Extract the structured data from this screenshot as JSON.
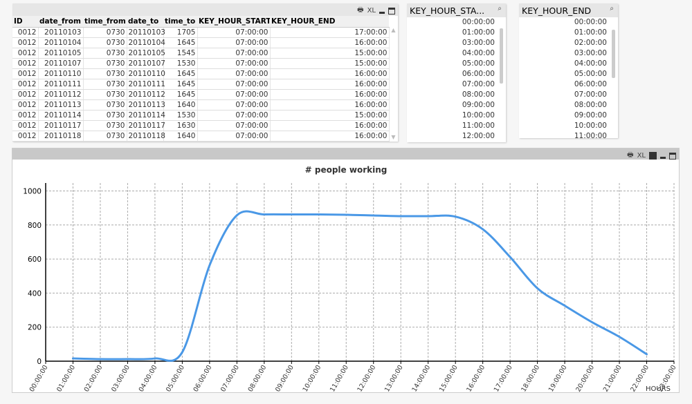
{
  "table": {
    "icons": [
      "print-icon",
      "xl-icon",
      "minimize-icon",
      "maximize-icon"
    ],
    "xl_label": "XL",
    "columns": [
      "ID",
      "date_from",
      "time_from",
      "date_to",
      "time_to",
      "KEY_HOUR_START",
      "KEY_HOUR_END"
    ],
    "rows": [
      [
        "0012",
        "20110103",
        "0730",
        "20110103",
        "1705",
        "07:00:00",
        "17:00:00"
      ],
      [
        "0012",
        "20110104",
        "0730",
        "20110104",
        "1645",
        "07:00:00",
        "16:00:00"
      ],
      [
        "0012",
        "20110105",
        "0730",
        "20110105",
        "1545",
        "07:00:00",
        "15:00:00"
      ],
      [
        "0012",
        "20110107",
        "0730",
        "20110107",
        "1530",
        "07:00:00",
        "15:00:00"
      ],
      [
        "0012",
        "20110110",
        "0730",
        "20110110",
        "1645",
        "07:00:00",
        "16:00:00"
      ],
      [
        "0012",
        "20110111",
        "0730",
        "20110111",
        "1645",
        "07:00:00",
        "16:00:00"
      ],
      [
        "0012",
        "20110112",
        "0730",
        "20110112",
        "1645",
        "07:00:00",
        "16:00:00"
      ],
      [
        "0012",
        "20110113",
        "0730",
        "20110113",
        "1640",
        "07:00:00",
        "16:00:00"
      ],
      [
        "0012",
        "20110114",
        "0730",
        "20110114",
        "1530",
        "07:00:00",
        "15:00:00"
      ],
      [
        "0012",
        "20110117",
        "0730",
        "20110117",
        "1630",
        "07:00:00",
        "16:00:00"
      ],
      [
        "0012",
        "20110118",
        "0730",
        "20110118",
        "1640",
        "07:00:00",
        "16:00:00"
      ]
    ]
  },
  "listbox_start": {
    "title": "KEY_HOUR_STA...",
    "items": [
      "00:00:00",
      "01:00:00",
      "03:00:00",
      "04:00:00",
      "05:00:00",
      "06:00:00",
      "07:00:00",
      "08:00:00",
      "09:00:00",
      "10:00:00",
      "11:00:00",
      "12:00:00"
    ]
  },
  "listbox_end": {
    "title": "KEY_HOUR_END",
    "items": [
      "00:00:00",
      "01:00:00",
      "02:00:00",
      "03:00:00",
      "04:00:00",
      "05:00:00",
      "06:00:00",
      "07:00:00",
      "08:00:00",
      "09:00:00",
      "10:00:00",
      "11:00:00"
    ]
  },
  "chart_caption": {
    "xl_label": "XL"
  },
  "chart_data": {
    "type": "line",
    "title": "# people working",
    "xlabel": "HOURS",
    "ylabel": "",
    "x_ticks": [
      "00:00:00",
      "01:00:00",
      "02:00:00",
      "03:00:00",
      "04:00:00",
      "05:00:00",
      "06:00:00",
      "07:00:00",
      "08:00:00",
      "09:00:00",
      "10:00:00",
      "11:00:00",
      "12:00:00",
      "13:00:00",
      "14:00:00",
      "15:00:00",
      "16:00:00",
      "17:00:00",
      "18:00:00",
      "19:00:00",
      "20:00:00",
      "21:00:00",
      "22:00:00",
      "23:00:00"
    ],
    "y_ticks": [
      0,
      200,
      400,
      600,
      800,
      1000
    ],
    "ylim": [
      0,
      1050
    ],
    "grid": true,
    "line_color": "#4a98e6",
    "x": [
      "01:00:00",
      "02:00:00",
      "03:00:00",
      "04:00:00",
      "05:00:00",
      "06:00:00",
      "07:00:00",
      "08:00:00",
      "09:00:00",
      "10:00:00",
      "11:00:00",
      "12:00:00",
      "13:00:00",
      "14:00:00",
      "15:00:00",
      "16:00:00",
      "17:00:00",
      "18:00:00",
      "19:00:00",
      "20:00:00",
      "21:00:00",
      "22:00:00"
    ],
    "values": [
      16,
      12,
      12,
      16,
      53,
      563,
      857,
      862,
      862,
      862,
      860,
      856,
      852,
      852,
      849,
      775,
      612,
      428,
      326,
      229,
      143,
      41
    ]
  }
}
